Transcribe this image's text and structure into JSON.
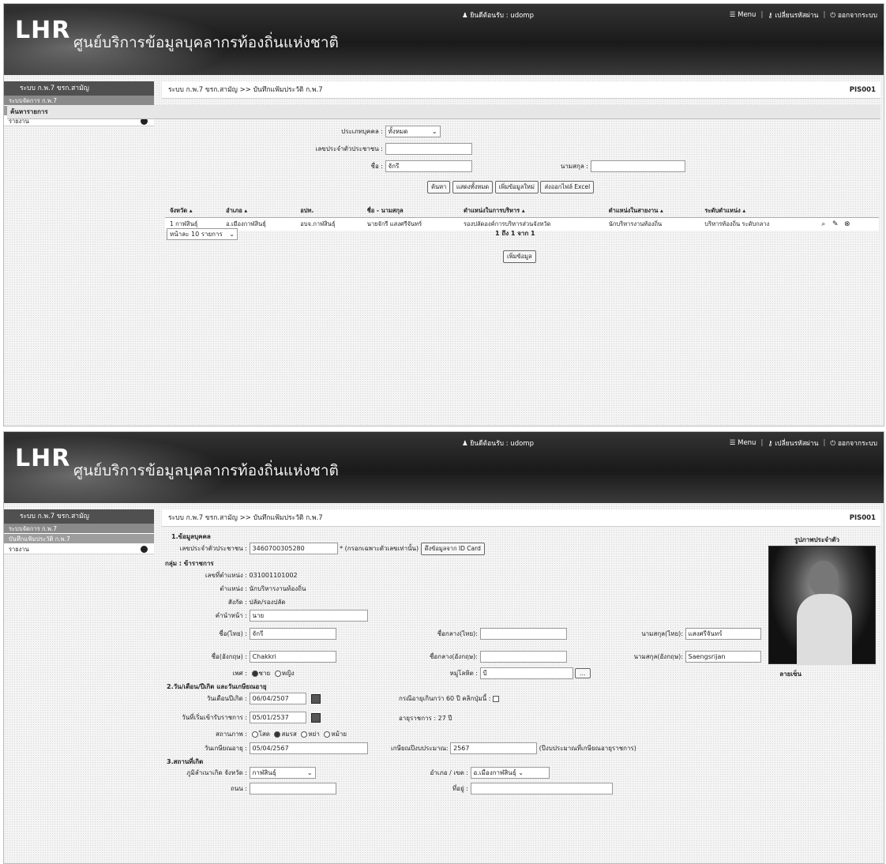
{
  "header": {
    "logo": "LHR",
    "org_name": "ศูนย์บริการข้อมูลบุคลากรท้องถิ่นแห่งชาติ",
    "user_label": "ยินดีต้อนรับ : udomp",
    "menu": "Menu",
    "change_password": "เปลี่ยนรหัสผ่าน",
    "logout": "ออกจากระบบ"
  },
  "sidebar": {
    "system": "ระบบ ก.พ.7 ขรก.สามัญ",
    "items": [
      "ระบบจัดการ ก.พ.7",
      "บันทึกแฟ้มประวัติ ก.พ.7",
      "รายงาน"
    ]
  },
  "page": {
    "breadcrumb": "ระบบ ก.พ.7 ขรก.สามัญ >> บันทึกแฟ้มประวัติ ก.พ.7",
    "page_id": "PIS001"
  },
  "search": {
    "title": "ค้นหารายการ",
    "person_type_label": "ประเภทบุคคล :",
    "person_type_value": "ทั้งหมด",
    "id_label": "เลขประจำตัวประชาชน :",
    "id_value": "",
    "name_label": "ชื่อ :",
    "name_value": "จักรี",
    "surname_label": "นามสกุล :",
    "surname_value": "",
    "buttons": [
      "ค้นหา",
      "แสดงทั้งหมด",
      "เพิ่มข้อมูลใหม่",
      "ส่งออกไฟล์ Excel"
    ]
  },
  "results": {
    "columns": [
      "จังหวัด",
      "อำเภอ",
      "อปท.",
      "ชื่อ - นามสกุล",
      "ตำแหน่งในการบริหาร",
      "ตำแหน่งในสายงาน",
      "ระดับตำแหน่ง"
    ],
    "rows": [
      [
        "1  กาฬสินธุ์",
        "อ.เมืองกาฬสินธุ์",
        "อบจ.กาฬสินธุ์",
        "นายจักรี แสงศรีจันทร์",
        "รองปลัดองค์การบริหารส่วนจังหวัด",
        "นักบริหารงานท้องถิ่น",
        "บริหารท้องถิ่น ระดับกลาง"
      ]
    ],
    "page_size": "หน้าละ 10 รายการ",
    "pager": "1 ถึง 1 จาก 1",
    "add_button": "เพิ่มข้อมูล"
  },
  "form": {
    "sec1_title": "1.ข้อมูลบุคคล",
    "id_label": "เลขประจำตัวประชาชน :",
    "id_value": "3460700305280",
    "id_hint": "* (กรอกเฉพาะตัวเลขเท่านั้น)",
    "id_card_button": "ดึงข้อมูลจาก ID Card",
    "group_label": "กลุ่ม : ข้าราชการ",
    "pos_no_label": "เลขที่ตำแหน่ง :",
    "pos_no_value": "031001101002",
    "position_label": "ตำแหน่ง :",
    "position_value": "นักบริหารงานท้องถิ่น",
    "affiliation_label": "สังกัด :",
    "affiliation_value": "ปลัด/รองปลัด",
    "prefix_label": "คำนำหน้า :",
    "prefix_value": "นาย",
    "name_th_label": "ชื่อ(ไทย) :",
    "name_th_value": "จักรี",
    "middle_th_label": "ชื่อกลาง(ไทย):",
    "surname_th_label": "นามสกุล(ไทย):",
    "surname_th_value": "แสงศรีจันทร์",
    "name_en_label": "ชื่อ(อังกฤษ) :",
    "name_en_value": "Chakkri",
    "middle_en_label": "ชื่อกลาง(อังกฤษ):",
    "surname_en_label": "นามสกุล(อังกฤษ):",
    "surname_en_value": "Saengsrijan",
    "gender_label": "เพศ :",
    "gender_male": "ชาย",
    "gender_female": "หญิง",
    "blood_label": "หมู่โลหิต :",
    "blood_value": "บี",
    "photo_label": "รูปภาพประจำตัว",
    "signature_label": "ลายเซ็น",
    "sec2_title": "2.วัน/เดือน/ปีเกิด และวันเกษียณอายุ",
    "birth_label": "วันเดือนปีเกิด :",
    "birth_value": "06/04/2507",
    "over60_label": "กรณีอายุเกินกว่า 60 ปี คลิกปุ่มนี้ :",
    "start_label": "วันที่เริ่มเข้ารับราชการ :",
    "start_value": "05/01/2537",
    "service_label": "อายุราชการ : 27 ปี",
    "status_label": "สถานภาพ :",
    "status_options": [
      "โสด",
      "สมรส",
      "หย่า",
      "หม้าย"
    ],
    "retire_label": "วันเกษียณอายุ :",
    "retire_value": "05/04/2567",
    "fiscal_label": "เกษียณปีงบประมาณ:",
    "fiscal_value": "2567",
    "fiscal_note": "(ปีงบประมาณที่เกษียณอายุราชการ)",
    "sec3_title": "3.สถานที่เกิด",
    "province_label": "ภูมิลำเนาเกิด จังหวัด :",
    "province_value": "กาฬสินธุ์",
    "district_label": "อำเภอ / เขต :",
    "district_value": "อ.เมืองกาฬสินธุ์",
    "street_label": "ถนน :",
    "address_label": "ที่อยู่ :"
  }
}
